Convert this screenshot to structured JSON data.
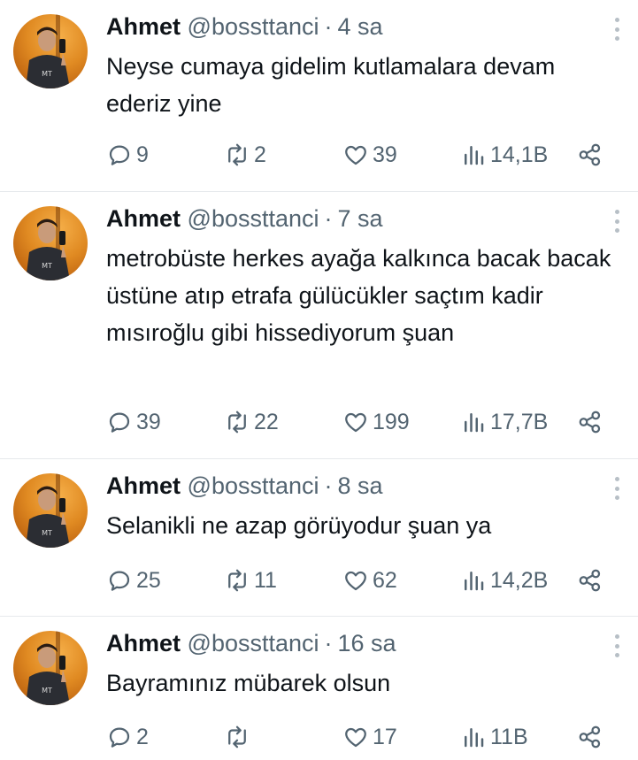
{
  "tweets": [
    {
      "author_name": "Ahmet",
      "handle": "@bossttanci",
      "separator": "·",
      "time": "4 sa",
      "text": "Neyse cumaya gidelim kutlamalara devam ederiz yine",
      "replies": "9",
      "retweets": "2",
      "likes": "39",
      "views": "14,1B"
    },
    {
      "author_name": "Ahmet",
      "handle": "@bossttanci",
      "separator": "·",
      "time": "7 sa",
      "text": "metrobüste herkes ayağa kalkınca bacak bacak üstüne atıp etrafa gülücükler saçtım kadir mısıroğlu gibi hissediyorum şuan",
      "replies": "39",
      "retweets": "22",
      "likes": "199",
      "views": "17,7B"
    },
    {
      "author_name": "Ahmet",
      "handle": "@bossttanci",
      "separator": "·",
      "time": "8 sa",
      "text": "Selanikli ne azap görüyodur şuan ya",
      "replies": "25",
      "retweets": "11",
      "likes": "62",
      "views": "14,2B"
    },
    {
      "author_name": "Ahmet",
      "handle": "@bossttanci",
      "separator": "·",
      "time": "16 sa",
      "text": "Bayramınız mübarek olsun",
      "replies": "2",
      "retweets": "",
      "likes": "17",
      "views": "11B"
    }
  ],
  "icons": {
    "reply": "reply-icon",
    "retweet": "retweet-icon",
    "like": "heart-icon",
    "views": "views-icon",
    "share": "share-icon",
    "more": "more-options-icon"
  },
  "colors": {
    "text_primary": "#0f1419",
    "text_secondary": "#536471",
    "divider": "#e6e9ec"
  }
}
